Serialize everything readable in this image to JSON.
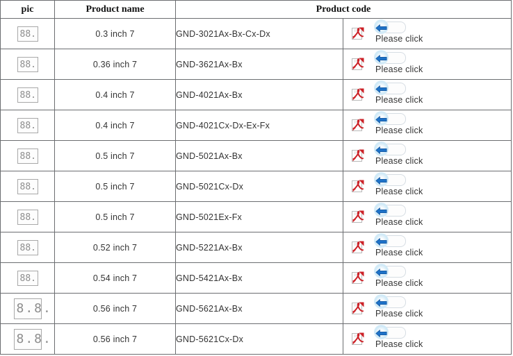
{
  "table": {
    "headers": {
      "pic": "pic",
      "product_name": "Product name",
      "product_code": "Product code"
    },
    "doc_label": "Please click",
    "icons": {
      "pdf": "pdf-icon",
      "arrow": "arrow-left-icon",
      "thumb": "seven-segment-display-thumbnail"
    },
    "colors": {
      "border": "#6b6d70",
      "text": "#333333",
      "header_text": "#111111",
      "pdf_red": "#cc2127",
      "arrow_blue": "#1e72c8",
      "badge_glow": "#cfe9f7",
      "thumb_border": "#a8a8a8",
      "thumb_digit": "#8d8d8d"
    },
    "rows": [
      {
        "pic": "88.",
        "pic_size": "small",
        "name": "0.3 inch 7",
        "code": "GND-3021Ax-Bx-Cx-Dx",
        "doc": "Please click"
      },
      {
        "pic": "88.",
        "pic_size": "small",
        "name": "0.36 inch 7",
        "code": "GND-3621Ax-Bx",
        "doc": "Please click"
      },
      {
        "pic": "88.",
        "pic_size": "small",
        "name": "0.4 inch 7",
        "code": "GND-4021Ax-Bx",
        "doc": "Please click"
      },
      {
        "pic": "88.",
        "pic_size": "small",
        "name": "0.4 inch 7",
        "code": "GND-4021Cx-Dx-Ex-Fx",
        "doc": "Please click"
      },
      {
        "pic": "88.",
        "pic_size": "small",
        "name": "0.5 inch 7",
        "code": "GND-5021Ax-Bx",
        "doc": "Please click"
      },
      {
        "pic": "88.",
        "pic_size": "small",
        "name": "0.5 inch 7",
        "code": "GND-5021Cx-Dx",
        "doc": "Please click"
      },
      {
        "pic": "88.",
        "pic_size": "small",
        "name": "0.5 inch 7",
        "code": "GND-5021Ex-Fx",
        "doc": "Please click"
      },
      {
        "pic": "88.",
        "pic_size": "small",
        "name": "0.52 inch 7",
        "code": "GND-5221Ax-Bx",
        "doc": "Please click"
      },
      {
        "pic": "88.",
        "pic_size": "small",
        "name": "0.54 inch 7",
        "code": "GND-5421Ax-Bx",
        "doc": "Please click"
      },
      {
        "pic": "8.8.",
        "pic_size": "large",
        "name": "0.56 inch 7",
        "code": "GND-5621Ax-Bx",
        "doc": "Please click"
      },
      {
        "pic": "8.8.",
        "pic_size": "large",
        "name": "0.56 inch 7",
        "code": "GND-5621Cx-Dx",
        "doc": "Please click"
      }
    ]
  }
}
